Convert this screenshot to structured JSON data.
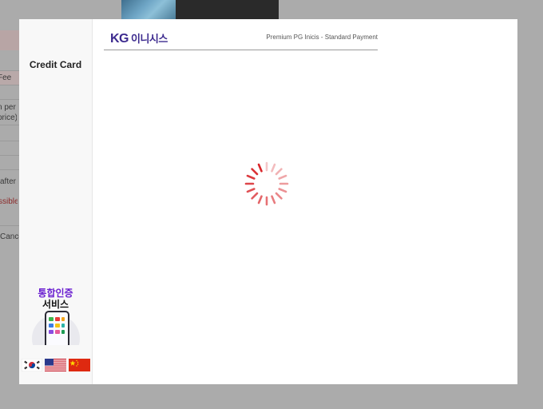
{
  "background": {
    "fragments": [
      "Fee",
      "n per",
      "price)",
      "after",
      "ssible",
      "Cance"
    ]
  },
  "modal": {
    "sidebar": {
      "title": "Credit Card",
      "auth_line1": "통합인증",
      "auth_line2": "서비스",
      "languages": [
        "korean-flag",
        "us-flag",
        "china-flag"
      ]
    },
    "header": {
      "logo_latin": "KG",
      "logo_korean": "이니시스",
      "subtitle": "Premium PG Inicis - Standard Payment"
    },
    "status": {
      "state": "loading"
    },
    "colors": {
      "brand": "#3c2a8e",
      "spinner": "#d9262b",
      "auth_accent": "#6a1fd0"
    }
  }
}
